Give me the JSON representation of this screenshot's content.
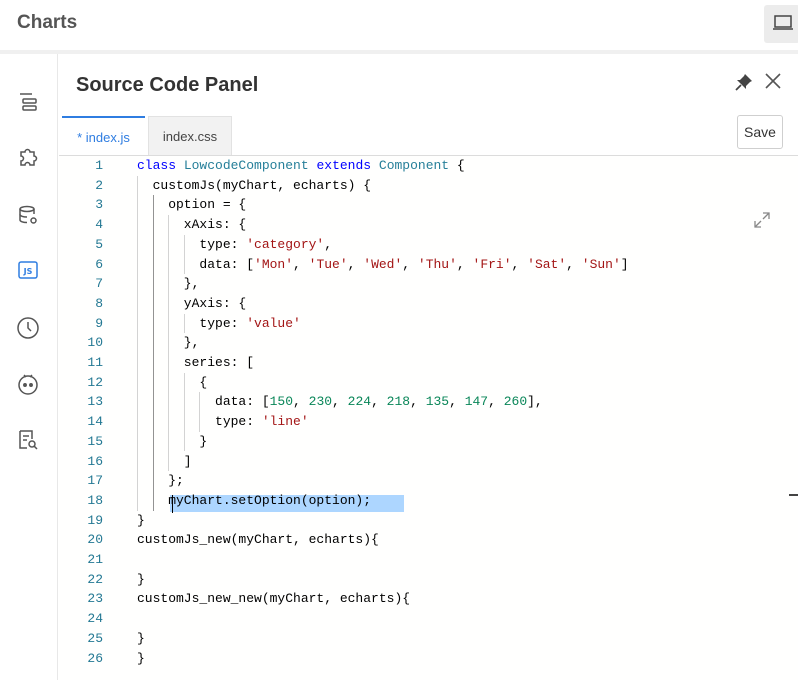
{
  "app": {
    "title": "Charts"
  },
  "panel": {
    "title": "Source Code Panel",
    "tabs": [
      {
        "label": "* index.js",
        "active": true
      },
      {
        "label": "index.css",
        "active": false
      }
    ],
    "save_label": "Save"
  },
  "sidebar": {
    "icons": [
      "outline-icon",
      "plugin-icon",
      "datasource-icon",
      "js-icon",
      "history-icon",
      "robot-icon",
      "search-doc-icon"
    ],
    "js_label": "JS"
  },
  "editor": {
    "language": "javascript",
    "selected_line": 18,
    "selected_text": "myChart.setOption(option);",
    "lines": [
      {
        "n": "1",
        "text": "class LowcodeComponent extends Component {"
      },
      {
        "n": "2",
        "text": "  customJs(myChart, echarts) {"
      },
      {
        "n": "3",
        "text": "    option = {"
      },
      {
        "n": "4",
        "text": "      xAxis: {"
      },
      {
        "n": "5",
        "text": "        type: 'category',"
      },
      {
        "n": "6",
        "text": "        data: ['Mon', 'Tue', 'Wed', 'Thu', 'Fri', 'Sat', 'Sun']"
      },
      {
        "n": "7",
        "text": "      },"
      },
      {
        "n": "8",
        "text": "      yAxis: {"
      },
      {
        "n": "9",
        "text": "        type: 'value'"
      },
      {
        "n": "10",
        "text": "      },"
      },
      {
        "n": "11",
        "text": "      series: ["
      },
      {
        "n": "12",
        "text": "        {"
      },
      {
        "n": "13",
        "text": "          data: [150, 230, 224, 218, 135, 147, 260],"
      },
      {
        "n": "14",
        "text": "          type: 'line'"
      },
      {
        "n": "15",
        "text": "        }"
      },
      {
        "n": "16",
        "text": "      ]"
      },
      {
        "n": "17",
        "text": "    };"
      },
      {
        "n": "18",
        "text": "    myChart.setOption(option);"
      },
      {
        "n": "19",
        "text": "}"
      },
      {
        "n": "20",
        "text": "customJs_new(myChart, echarts){"
      },
      {
        "n": "21",
        "text": ""
      },
      {
        "n": "22",
        "text": "}"
      },
      {
        "n": "23",
        "text": "customJs_new_new(myChart, echarts){"
      },
      {
        "n": "24",
        "text": ""
      },
      {
        "n": "25",
        "text": "}"
      },
      {
        "n": "26",
        "text": "}"
      }
    ]
  },
  "colors": {
    "accent": "#2f7de1",
    "keyword": "#0000ff",
    "type": "#267f99",
    "string": "#a31515",
    "number": "#098658",
    "line_number": "#237893",
    "selection": "#add6ff"
  }
}
